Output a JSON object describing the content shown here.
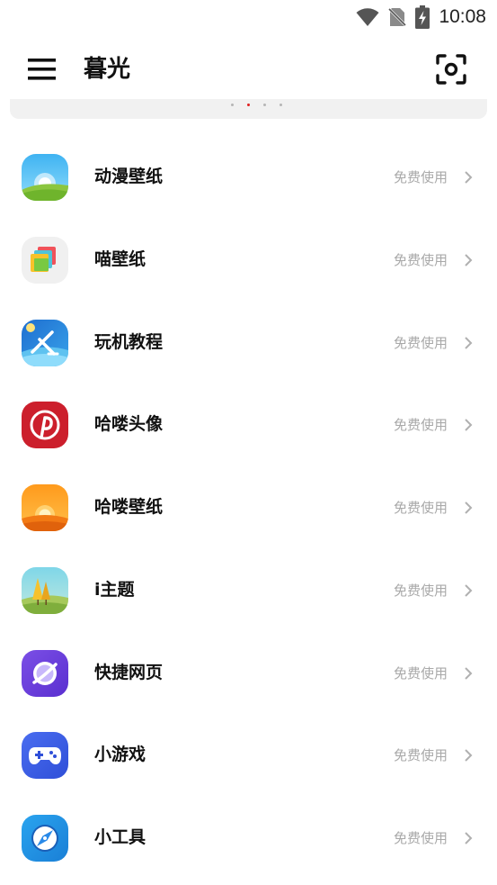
{
  "status_bar": {
    "time": "10:08",
    "icons": [
      "wifi-icon",
      "no-sim-icon",
      "battery-charging-icon"
    ]
  },
  "app_bar": {
    "title": "暮光",
    "menu_icon": "menu-icon",
    "scan_icon": "scan-icon"
  },
  "banner": {
    "dots_count": 4,
    "active_dot": 1,
    "accent": "#e02020"
  },
  "items": [
    {
      "label": "动漫壁纸",
      "action": "免费使用",
      "icon": "landscape-sky-icon"
    },
    {
      "label": "喵壁纸",
      "action": "免费使用",
      "icon": "stacked-cards-icon"
    },
    {
      "label": "玩机教程",
      "action": "免费使用",
      "icon": "satellite-icon"
    },
    {
      "label": "哈喽头像",
      "action": "免费使用",
      "icon": "pinterest-icon"
    },
    {
      "label": "哈喽壁纸",
      "action": "免费使用",
      "icon": "sunset-icon"
    },
    {
      "label": "i主题",
      "action": "免费使用",
      "icon": "trees-landscape-icon"
    },
    {
      "label": "快捷网页",
      "action": "免费使用",
      "icon": "planet-icon"
    },
    {
      "label": "小游戏",
      "action": "免费使用",
      "icon": "gamepad-icon"
    },
    {
      "label": "小工具",
      "action": "免费使用",
      "icon": "compass-icon"
    }
  ]
}
